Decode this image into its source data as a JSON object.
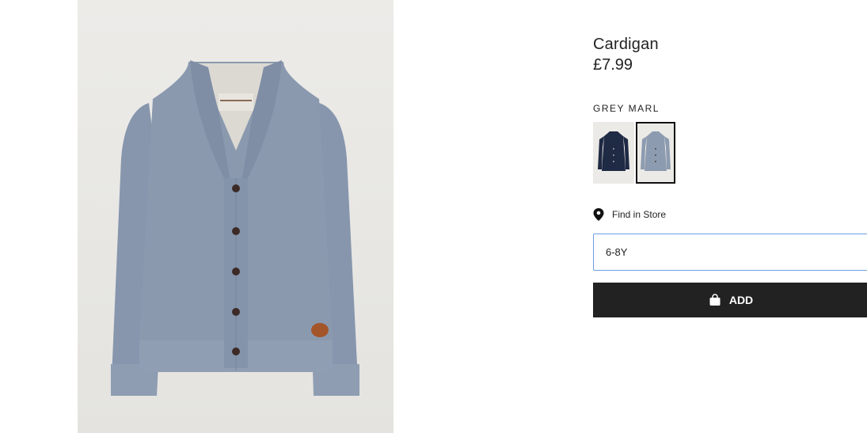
{
  "product": {
    "title": "Cardigan",
    "price": "£7.99",
    "color_label": "GREY MARL",
    "swatches": [
      {
        "name": "navy",
        "color": "#1f2a44",
        "selected": false
      },
      {
        "name": "grey marl",
        "color": "#8d9bb0",
        "selected": true
      }
    ],
    "main_image": {
      "garment_color": "#8c9ab0",
      "button_color": "#3b2a26",
      "patch_color": "#a4562b"
    }
  },
  "find_in_store": {
    "label": "Find in Store",
    "icon": "location-pin-icon"
  },
  "size_select": {
    "value": "6-8Y"
  },
  "add_button": {
    "label": "ADD",
    "icon": "shopping-bag-icon"
  }
}
